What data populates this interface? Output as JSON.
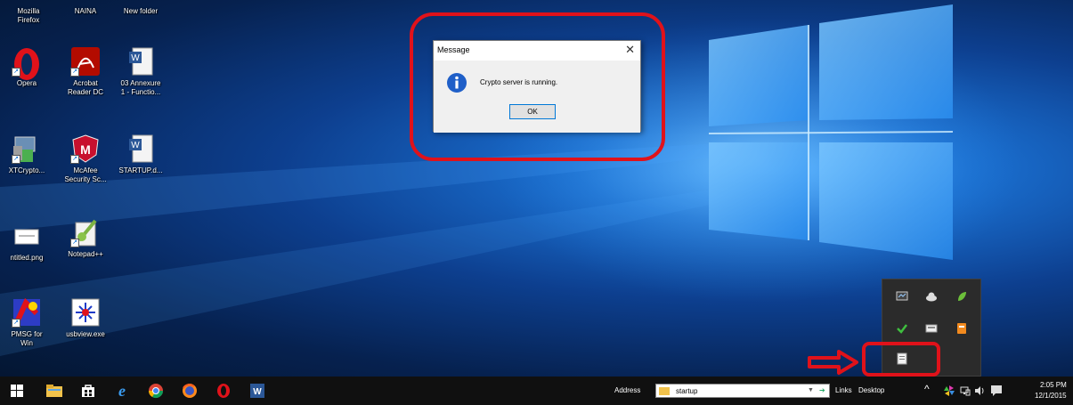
{
  "dialog": {
    "title": "Message",
    "close_glyph": "✕",
    "message": "Crypto server is running.",
    "ok_label": "OK",
    "icon": "information-icon"
  },
  "desktop_icons": [
    {
      "label": "Mozilla\nFirefox",
      "icon": "firefox-icon"
    },
    {
      "label": "NAINA",
      "icon": "folder-icon"
    },
    {
      "label": "New folder",
      "icon": "folder-icon"
    },
    {
      "label": "Opera",
      "icon": "opera-icon"
    },
    {
      "label": "Acrobat\nReader DC",
      "icon": "acrobat-icon"
    },
    {
      "label": "03 Annexure\n1 - Functio...",
      "icon": "word-document-icon"
    },
    {
      "label": "XTCrypto...",
      "icon": "xtcrypto-icon"
    },
    {
      "label": "McAfee\nSecurity Sc...",
      "icon": "mcafee-icon"
    },
    {
      "label": "STARTUP.d...",
      "icon": "word-document-icon"
    },
    {
      "label": "ntitled.png",
      "icon": "image-file-icon"
    },
    {
      "label": "Notepad++",
      "icon": "notepadpp-icon"
    },
    {
      "label": "PMSG for\nWin",
      "icon": "ipmsg-icon"
    },
    {
      "label": "usbview.exe",
      "icon": "usbview-icon"
    }
  ],
  "taskbar": {
    "pinned": [
      "windows-start-icon",
      "file-explorer-icon",
      "store-icon",
      "edge-icon",
      "chrome-icon",
      "firefox-icon",
      "opera-icon",
      "word-icon"
    ],
    "address_label": "Address",
    "address_value": "startup",
    "links_label": "Links",
    "desktop_label": "Desktop",
    "chevron": "^",
    "clock_time": "2:05 PM",
    "clock_date": "12/1/2015"
  },
  "tray_flyout": {
    "icons": [
      "network-monitor-icon",
      "cloud-icon",
      "green-leaf-icon",
      "check-icon",
      "keyboard-icon",
      "orange-app-icon",
      "crypto-server-tray-icon"
    ]
  },
  "colors": {
    "annotation_red": "#e0121a",
    "taskbar": "#101010",
    "dialog_bg": "#f0f0f0"
  }
}
